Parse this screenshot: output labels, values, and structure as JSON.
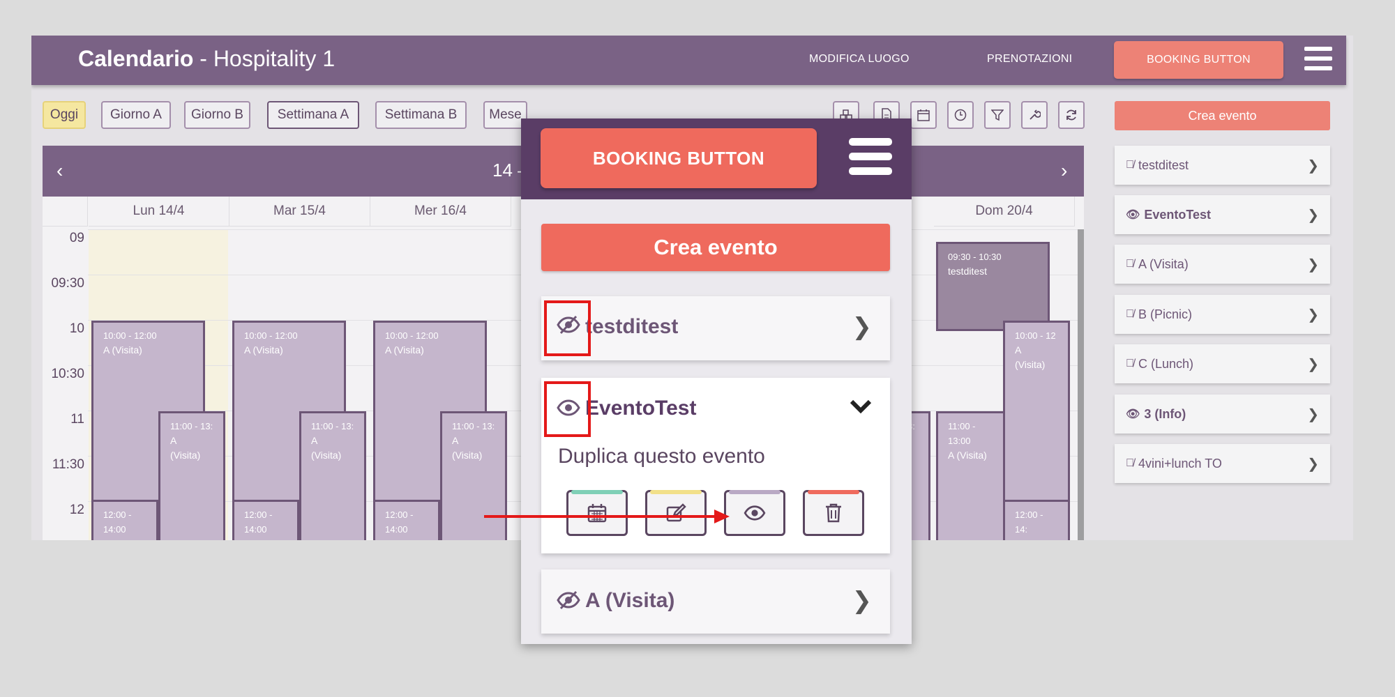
{
  "header": {
    "title_bold": "Calendario",
    "title_rest": " - Hospitality 1",
    "nav": [
      "MODIFICA LUOGO",
      "PRENOTAZIONI"
    ],
    "booking_button": "BOOKING BUTTON",
    "menu_icon": "hamburger-icon"
  },
  "view_buttons": [
    "Oggi",
    "Giorno A",
    "Giorno B",
    "Settimana A",
    "Settimana B",
    "Mese"
  ],
  "toolbar_icons": [
    "boxes-icon",
    "document-icon",
    "calendar-icon",
    "clock-icon",
    "filter-icon",
    "wrench-icon",
    "refresh-icon"
  ],
  "calendar": {
    "range": "14 –",
    "prev": "‹",
    "next": "›",
    "days": [
      "Lun 14/4",
      "Mar 15/4",
      "Mer 16/4",
      "Dom 20/4"
    ],
    "times": [
      "09",
      "09:30",
      "10",
      "10:30",
      "11",
      "11:30",
      "12"
    ],
    "events": {
      "visita_10_12": "10:00 - 12:00",
      "visita_11_13": "11:00 - 13:",
      "visita_12_14": "12:00 - 14:00",
      "visita_label": "A (Visita)",
      "a_label": "A",
      "visita_paren": "(Visita)",
      "dom_930": "09:30 - 10:30",
      "dom_930_name": "testditest",
      "dom_10_12": "10:00 - 12",
      "dom_11_13": "11:00 - 13:00",
      "dom_12_14": "12:00 - 14:",
      "wed_partial_3": "3:",
      "wed_partial_paren": ")"
    }
  },
  "right_panel": {
    "crea_evento": "Crea evento",
    "items": [
      {
        "label": "testditest",
        "visible": false
      },
      {
        "label": "EventoTest",
        "visible": true
      },
      {
        "label": "A (Visita)",
        "visible": false
      },
      {
        "label": "B (Picnic)",
        "visible": false
      },
      {
        "label": "C (Lunch)",
        "visible": false
      },
      {
        "label": "3 (Info)",
        "visible": true
      },
      {
        "label": "4vini+lunch TO",
        "visible": false
      }
    ]
  },
  "panel": {
    "booking_button": "BOOKING BUTTON",
    "crea_evento": "Crea evento",
    "items": [
      "testditest",
      "EventoTest",
      "A (Visita)"
    ],
    "duplica": "Duplica questo evento",
    "actions": [
      "calendar-icon",
      "edit-icon",
      "eye-icon",
      "trash-icon"
    ],
    "action_colors": [
      "#7fcfb6",
      "#f2e08a",
      "#b9a9c4",
      "#ef6a5d"
    ]
  },
  "colors": {
    "brand_purple": "#7a6285",
    "dark_purple": "#5a3d66",
    "accent_coral": "#ef6a5d",
    "annotation_red": "#e41919"
  }
}
